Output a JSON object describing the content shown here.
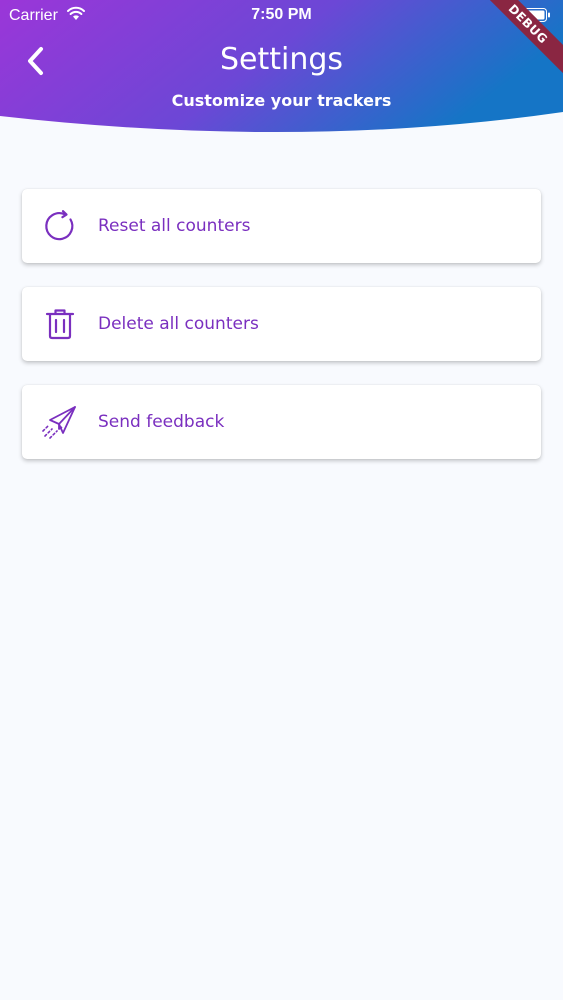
{
  "status_bar": {
    "carrier": "Carrier",
    "time": "7:50 PM",
    "wifi_icon": "wifi-icon",
    "battery_icon": "battery-icon"
  },
  "debug_banner": "DEBUG",
  "header": {
    "title": "Settings",
    "subtitle": "Customize your trackers",
    "back_icon": "chevron-left-icon",
    "gradient_start": "#9b36d8",
    "gradient_end": "#1575c6"
  },
  "menu": {
    "items": [
      {
        "label": "Reset all counters",
        "icon": "refresh-icon"
      },
      {
        "label": "Delete all counters",
        "icon": "trash-icon"
      },
      {
        "label": "Send feedback",
        "icon": "paper-plane-icon"
      }
    ]
  },
  "colors": {
    "accent": "#7a2fbf",
    "background": "#f8fafe",
    "card": "#ffffff",
    "debug": "#8a2642"
  }
}
